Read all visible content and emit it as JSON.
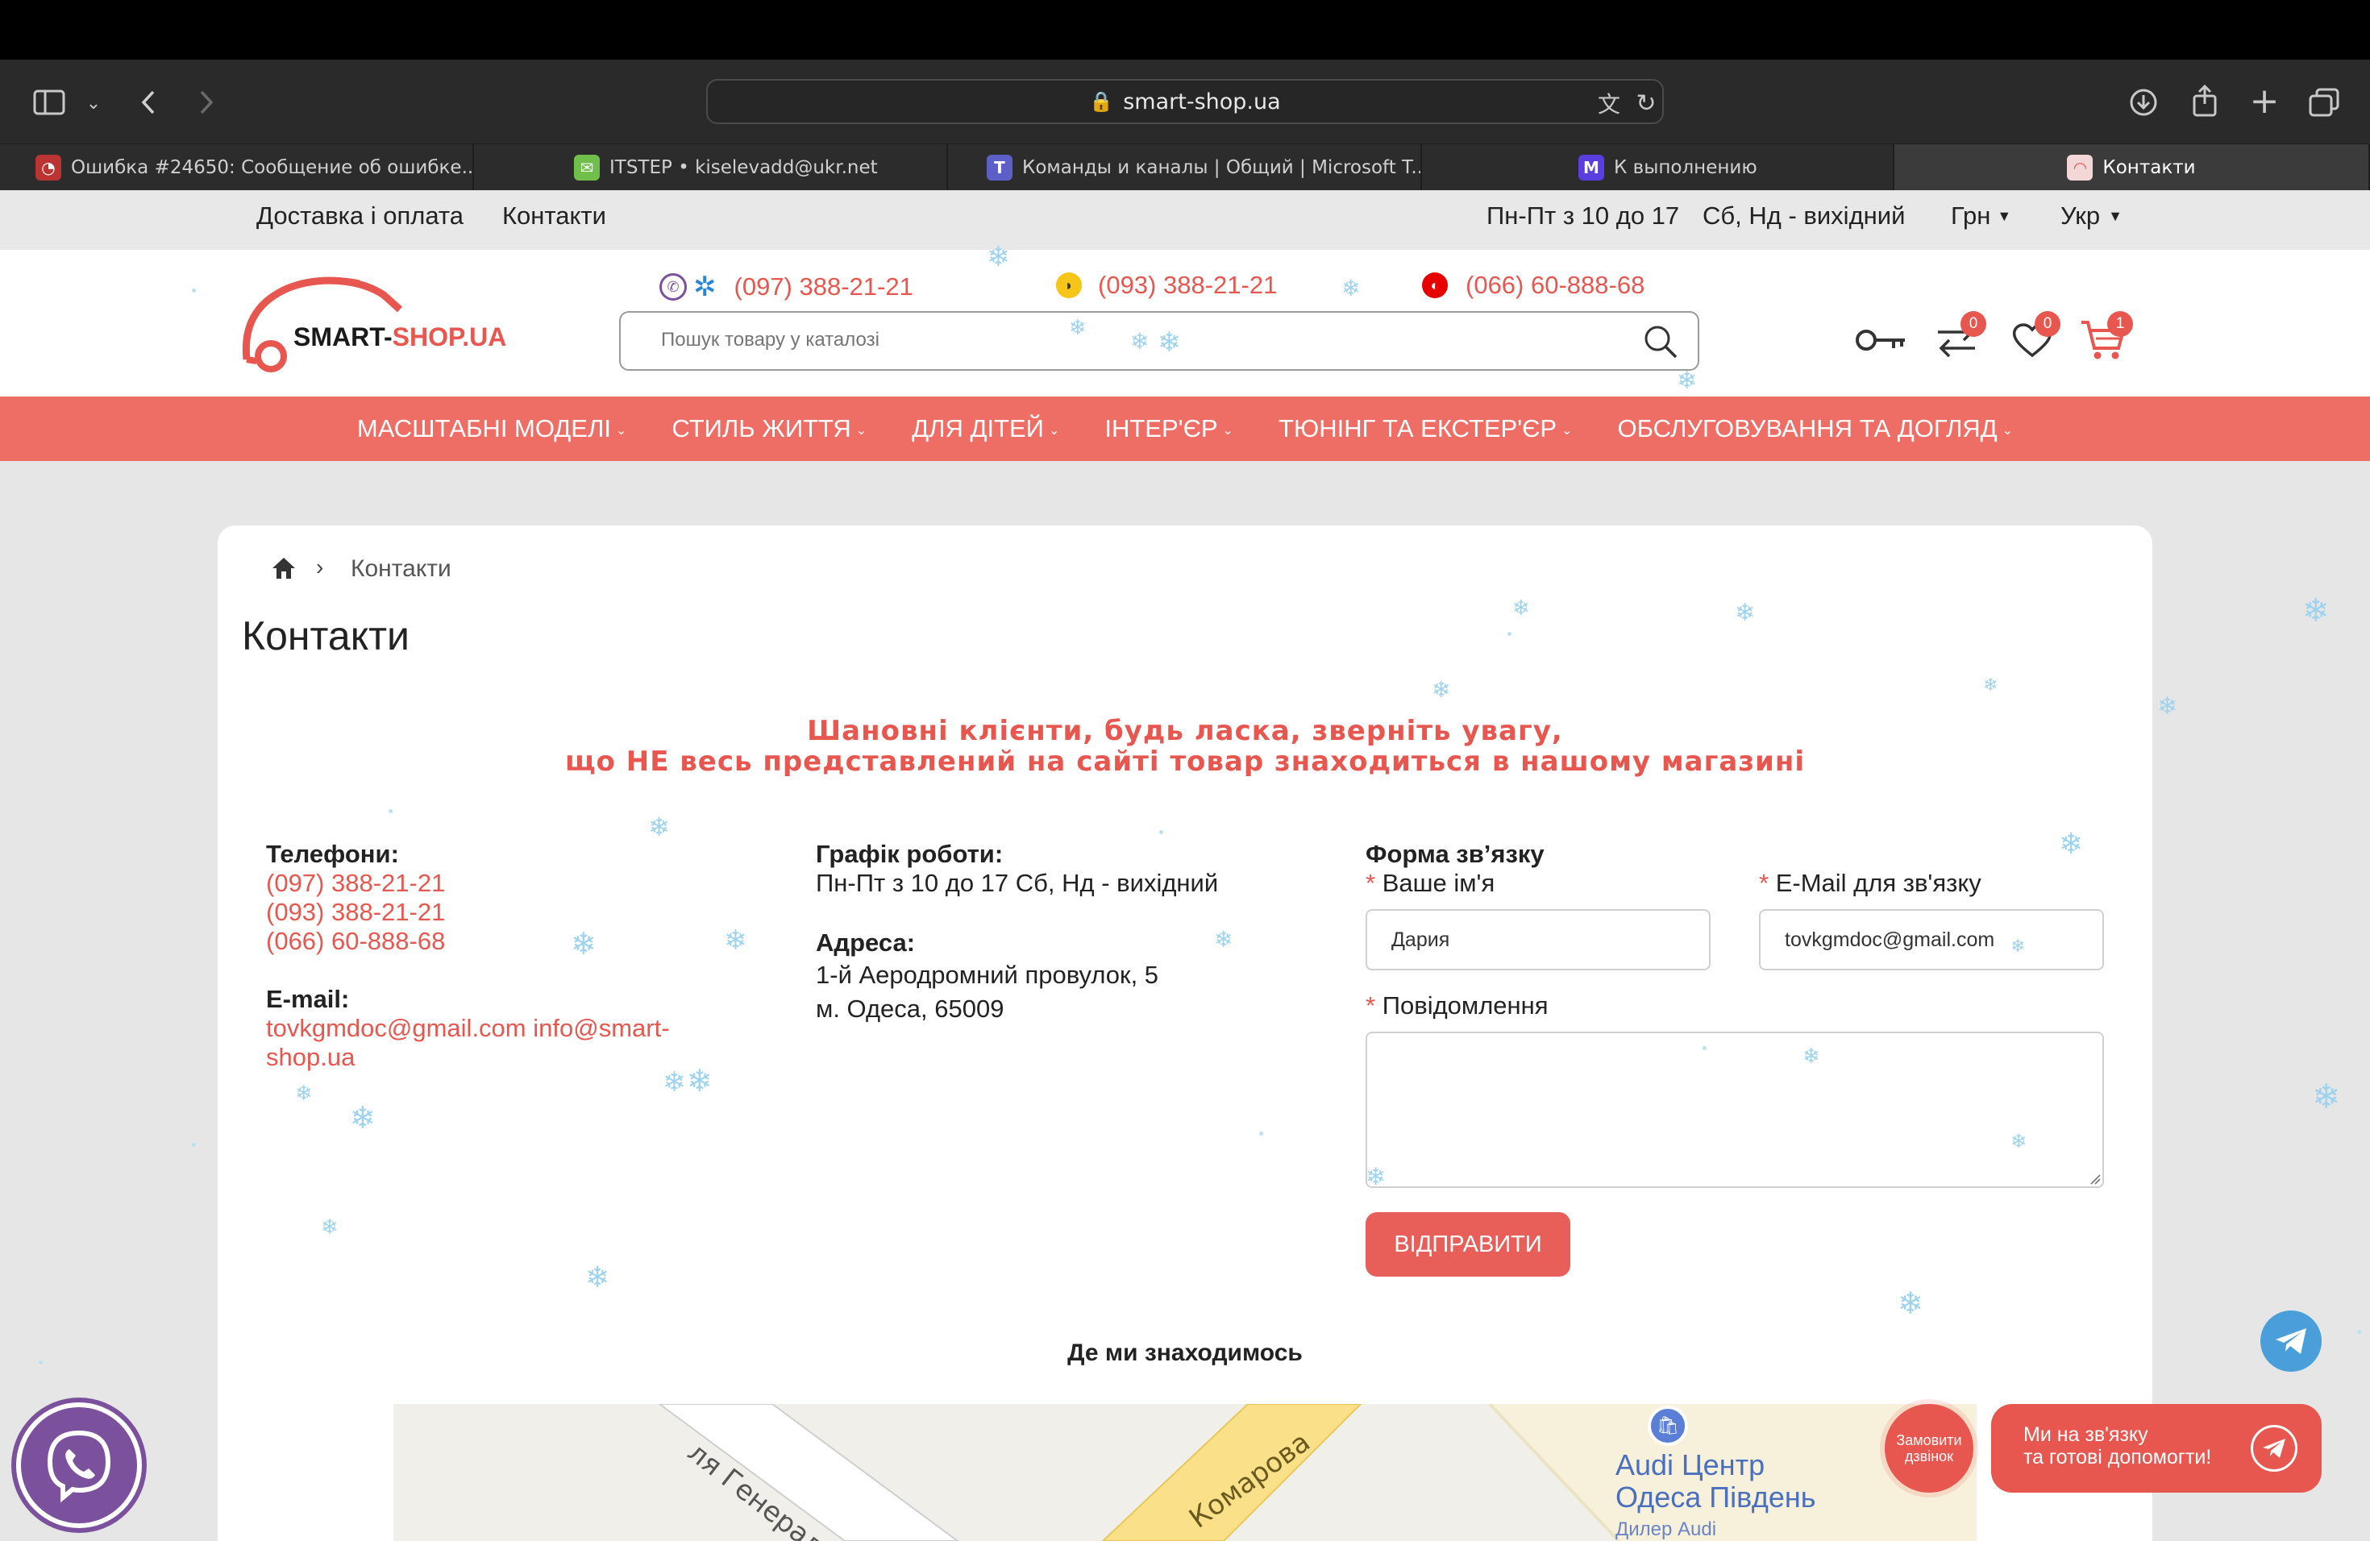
{
  "browser": {
    "url": "smart-shop.ua",
    "tabs": [
      {
        "title": "Ошибка #24650: Сообщение об ошибке...",
        "icon": "redmine-icon"
      },
      {
        "title": "ITSTEP • kiselevadd@ukr.net",
        "icon": "mail-icon"
      },
      {
        "title": "Команды и каналы | Общий | Microsoft T...",
        "icon": "teams-icon"
      },
      {
        "title": "К выполнению",
        "icon": "tasks-icon"
      },
      {
        "title": "Контакти",
        "icon": "smart-shop-favicon",
        "active": true
      }
    ]
  },
  "topbar": {
    "links": [
      "Доставка і оплата",
      "Контакти"
    ],
    "hours_weekdays": "Пн-Пт з 10 до 17",
    "hours_weekend": "Сб, Нд - вихідний",
    "currency": "Грн",
    "language": "Укр"
  },
  "header": {
    "logo_text_black": "SMART-",
    "logo_text_red": "SHOP.UA",
    "phones": [
      "(097) 388-21-21",
      "(093) 388-21-21",
      "(066) 60-888-68"
    ],
    "search_placeholder": "Пошук товару у каталозі",
    "compare_count": "0",
    "wishlist_count": "0",
    "cart_count": "1"
  },
  "nav": [
    "МАСШТАБНІ МОДЕЛІ",
    "СТИЛЬ ЖИТТЯ",
    "ДЛЯ ДІТЕЙ",
    "ІНТЕР'ЄР",
    "ТЮНІНГ ТА ЕКСТЕР'ЄР",
    "ОБСЛУГОВУВАННЯ ТА ДОГЛЯД"
  ],
  "page": {
    "breadcrumb_current": "Контакти",
    "title": "Контакти",
    "notice_line1": "Шановні клієнти, будь ласка, зверніть увагу,",
    "notice_line2": "що НЕ весь представлений на сайті товар знаходиться в нашому магазині",
    "phones_label": "Телефони:",
    "phones": [
      "(097) 388-21-21",
      "(093) 388-21-21",
      "(066) 60-888-68"
    ],
    "email_label": "E-mail:",
    "email_line1": "tovkgmdoc@gmail.com info@smart-",
    "email_line2": "shop.ua",
    "schedule_label": "Графік роботи:",
    "schedule": "Пн-Пт з 10 до 17 Сб, Нд - вихідний",
    "address_label": "Адреса:",
    "address_line1": "1-й Аеродромний провулок, 5",
    "address_line2": "м. Одеса, 65009",
    "map_title": "Де ми знаходимось"
  },
  "form": {
    "title": "Форма зв’язку",
    "name_label": "Ваше ім'я",
    "name_value": "Дария",
    "email_label": "E-Mail для зв'язку",
    "email_value": "tovkgmdoc@gmail.com",
    "message_label": "Повідомлення",
    "message_value": "",
    "submit": "ВІДПРАВИТИ",
    "required_mark": "*"
  },
  "map": {
    "street1": "ля Генерала",
    "street2": "Комарова",
    "poi_line1": "Audi Центр",
    "poi_line2": "Одеса Південь",
    "poi_line3": "Дилер Audi"
  },
  "widgets": {
    "callback": "Замовити дзвінок",
    "chat_line1": "Ми на зв'язку",
    "chat_line2": "та готові допомогти!"
  },
  "colors": {
    "accent": "#e8574f",
    "nav": "#ee6e66",
    "snow": "#9ed3f0"
  }
}
